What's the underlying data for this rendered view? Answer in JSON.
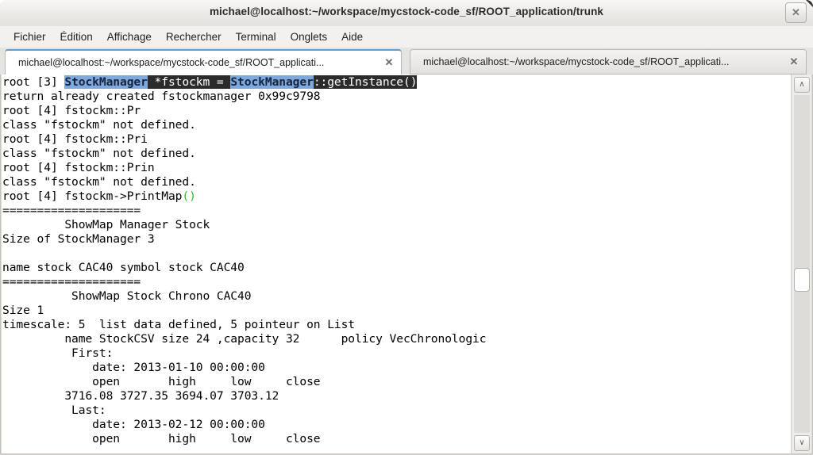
{
  "window": {
    "title": "michael@localhost:~/workspace/mycstock-code_sf/ROOT_application/trunk",
    "close_glyph": "✕"
  },
  "menu": {
    "items": [
      {
        "label": "Fichier"
      },
      {
        "label": "Édition"
      },
      {
        "label": "Affichage"
      },
      {
        "label": "Rechercher"
      },
      {
        "label": "Terminal"
      },
      {
        "label": "Onglets"
      },
      {
        "label": "Aide"
      }
    ]
  },
  "tabs": {
    "close_glyph": "✕",
    "items": [
      {
        "label": "michael@localhost:~/workspace/mycstock-code_sf/ROOT_applicati...",
        "active": true
      },
      {
        "label": "michael@localhost:~/workspace/mycstock-code_sf/ROOT_applicati...",
        "active": false
      }
    ]
  },
  "scrollbar": {
    "up_glyph": "∧",
    "down_glyph": "∨"
  },
  "terminal": {
    "prompt_line": {
      "prefix": "root [3] ",
      "segments": [
        {
          "text": "StockManager",
          "style": "keyword"
        },
        {
          "text": " *fstockm = ",
          "style": "command"
        },
        {
          "text": "StockManager",
          "style": "keyword"
        },
        {
          "text": "::getInstance()",
          "style": "command"
        }
      ]
    },
    "lines": [
      "return already created fstockmanager 0x99c9798",
      "root [4] fstockm::Pr",
      "class \"fstockm\" not defined.",
      "root [4] fstockm::Pri",
      "class \"fstockm\" not defined.",
      "root [4] fstockm::Prin",
      "class \"fstockm\" not defined."
    ],
    "printmap_line": {
      "prefix": "root [4] fstockm->PrintMap",
      "paren": "()"
    },
    "output_lines": [
      "====================",
      "         ShowMap Manager Stock",
      "Size of StockManager 3",
      "",
      "name stock CAC40 symbol stock CAC40",
      "====================",
      "          ShowMap Stock Chrono CAC40",
      "Size 1",
      "timescale: 5  list data defined, 5 pointeur on List",
      "         name StockCSV size 24 ,capacity 32      policy VecChronologic",
      "          First:",
      "             date: 2013-01-10 00:00:00",
      "             open       high     low     close",
      "         3716.08 3727.35 3694.07 3703.12",
      "          Last:",
      "             date: 2013-02-12 00:00:00",
      "             open       high     low     close"
    ]
  }
}
